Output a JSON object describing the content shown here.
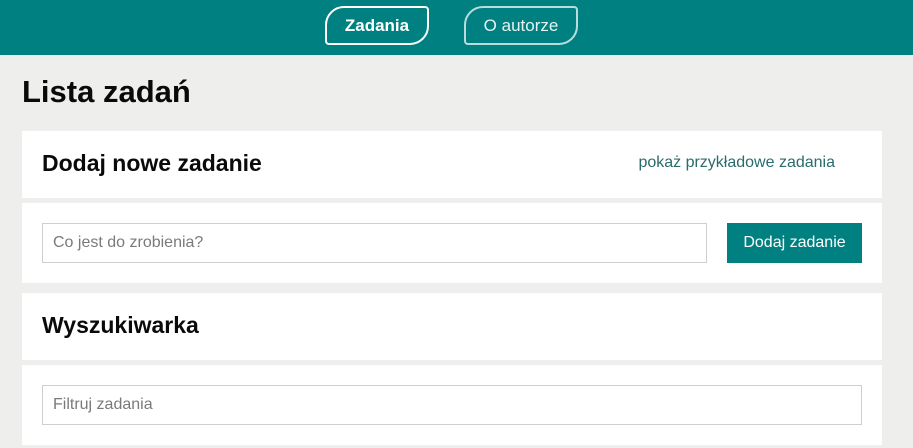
{
  "nav": {
    "tabs": [
      {
        "label": "Zadania",
        "active": true
      },
      {
        "label": "O autorze",
        "active": false
      }
    ]
  },
  "page": {
    "title": "Lista zadań"
  },
  "add_section": {
    "title": "Dodaj nowe zadanie",
    "example_link": "pokaż przykładowe zadania",
    "input_placeholder": "Co jest do zrobienia?",
    "input_value": "",
    "button_label": "Dodaj zadanie"
  },
  "search_section": {
    "title": "Wyszukiwarka",
    "input_placeholder": "Filtruj zadania",
    "input_value": ""
  },
  "colors": {
    "accent": "#008080",
    "background": "#eeeeed",
    "card": "#ffffff"
  }
}
